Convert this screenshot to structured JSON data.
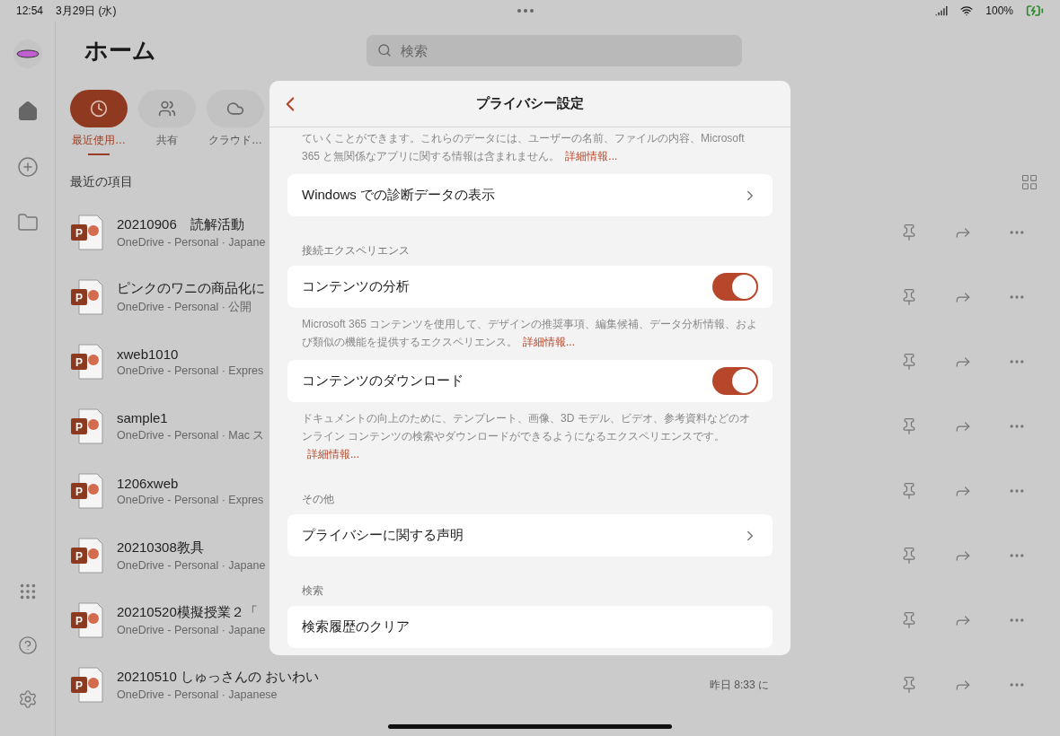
{
  "status_bar": {
    "time": "12:54",
    "date": "3月29日 (水)",
    "battery": "100%"
  },
  "header": {
    "title": "ホーム",
    "search": {
      "placeholder": "検索"
    }
  },
  "tabs": [
    {
      "label": "最近使用…",
      "kind": "recent",
      "selected": true
    },
    {
      "label": "共有",
      "kind": "shared",
      "selected": false
    },
    {
      "label": "クラウド…",
      "kind": "cloud",
      "selected": false
    }
  ],
  "section_title": "最近の項目",
  "files": [
    {
      "icon_letter": "P",
      "title": "20210906　読解活動",
      "subtitle": "OneDrive - Personal · Japane"
    },
    {
      "icon_letter": "P",
      "title": "ピンクのワニの商品化に",
      "subtitle": "OneDrive - Personal · 公開"
    },
    {
      "icon_letter": "P",
      "title": "xweb1010",
      "subtitle": "OneDrive - Personal · Expres"
    },
    {
      "icon_letter": "P",
      "title": "sample1",
      "subtitle": "OneDrive - Personal · Mac ス"
    },
    {
      "icon_letter": "P",
      "title": "1206xweb",
      "subtitle": "OneDrive - Personal · Expres"
    },
    {
      "icon_letter": "P",
      "title": "20210308教具",
      "subtitle": "OneDrive - Personal · Japane"
    },
    {
      "icon_letter": "P",
      "title": "20210520模擬授業２「",
      "subtitle": "OneDrive - Personal · Japane"
    },
    {
      "icon_letter": "P",
      "title": "20210510 しゅっさんの おいわい",
      "subtitle": "OneDrive - Personal · Japanese",
      "time": "昨日 8:33 に"
    }
  ],
  "dialog": {
    "title": "プライバシー設定",
    "items": [
      {
        "kind": "note",
        "text": "ていくことができます。これらのデータには、ユーザーの名前、ファイルの内容、Microsoft 365 と無関係なアプリに関する情報は含まれません。",
        "link": "詳細情報..."
      },
      {
        "kind": "nav",
        "label": "Windows での診断データの表示"
      },
      {
        "kind": "heading",
        "text": "接続エクスペリエンス"
      },
      {
        "kind": "toggle",
        "label": "コンテンツの分析",
        "on": true
      },
      {
        "kind": "note",
        "text": "Microsoft 365 コンテンツを使用して、デザインの推奨事項、編集候補、データ分析情報、および類似の機能を提供するエクスペリエンス。",
        "link": "詳細情報..."
      },
      {
        "kind": "toggle",
        "label": "コンテンツのダウンロード",
        "on": true
      },
      {
        "kind": "note",
        "text": "ドキュメントの向上のために、テンプレート、画像、3D モデル、ビデオ、参考資料などのオンライン コンテンツの検索やダウンロードができるようになるエクスペリエンスです。",
        "link": "詳細情報..."
      },
      {
        "kind": "heading",
        "text": "その他"
      },
      {
        "kind": "nav",
        "label": "プライバシーに関する声明"
      },
      {
        "kind": "heading",
        "text": "検索"
      },
      {
        "kind": "action",
        "label": "検索履歴のクリア"
      }
    ]
  }
}
